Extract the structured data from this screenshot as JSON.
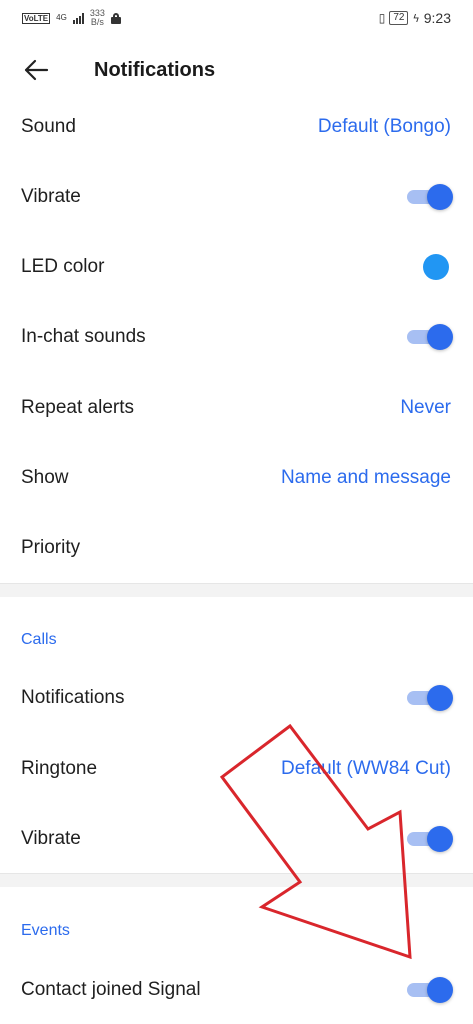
{
  "status_bar": {
    "volte": "VoLTE",
    "network": "4G",
    "speed_value": "333",
    "speed_unit": "B/s",
    "battery": "72",
    "time": "9:23"
  },
  "header": {
    "title": "Notifications"
  },
  "messages": {
    "sound_label": "Sound",
    "sound_value": "Default (Bongo)",
    "vibrate_label": "Vibrate",
    "vibrate_on": true,
    "led_label": "LED color",
    "led_color": "#2196f3",
    "in_chat_label": "In-chat sounds",
    "in_chat_on": true,
    "repeat_label": "Repeat alerts",
    "repeat_value": "Never",
    "show_label": "Show",
    "show_value": "Name and message",
    "priority_label": "Priority"
  },
  "calls": {
    "header": "Calls",
    "notifications_label": "Notifications",
    "notifications_on": true,
    "ringtone_label": "Ringtone",
    "ringtone_value": "Default (WW84 Cut)",
    "vibrate_label": "Vibrate",
    "vibrate_on": true
  },
  "events": {
    "header": "Events",
    "contact_joined_label": "Contact joined Signal",
    "contact_joined_on": true
  },
  "colors": {
    "accent": "#2c6bed",
    "toggle_track": "#a7bff3",
    "annotation_arrow": "#d9262c"
  },
  "icons": {
    "back": "arrow-left-icon",
    "annotation": "red-arrow-outline"
  }
}
